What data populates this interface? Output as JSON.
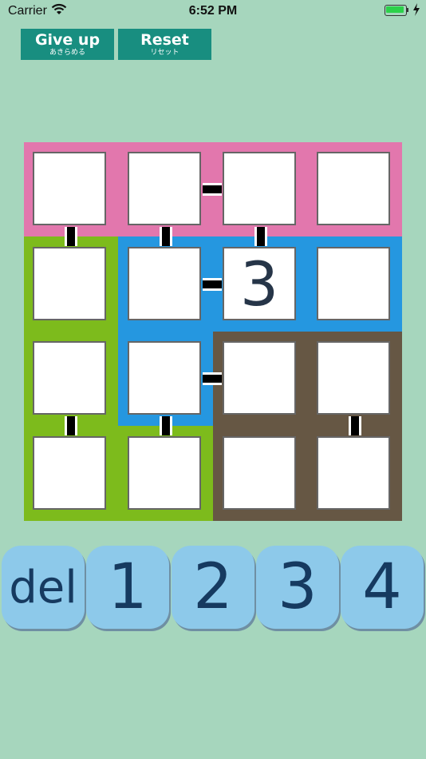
{
  "status_bar": {
    "carrier": "Carrier",
    "time": "6:52 PM"
  },
  "toolbar": {
    "give_up": {
      "label": "Give up",
      "sublabel": "あきらめる"
    },
    "reset": {
      "label": "Reset",
      "sublabel": "リセット"
    }
  },
  "board": {
    "size": 4,
    "region_colors": {
      "pink": "#e277ad",
      "green": "#7dbb1c",
      "blue": "#2597e0",
      "brown": "#665744"
    },
    "cells": [
      [
        "",
        "",
        "",
        ""
      ],
      [
        "",
        "",
        "3",
        ""
      ],
      [
        "",
        "",
        "",
        ""
      ],
      [
        "",
        "",
        "",
        ""
      ]
    ]
  },
  "keypad": {
    "keys": [
      "del",
      "1",
      "2",
      "3",
      "4"
    ]
  }
}
